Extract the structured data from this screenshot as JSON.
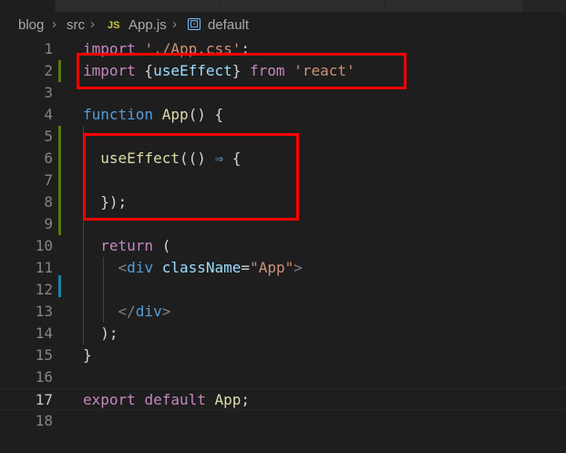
{
  "breadcrumb": {
    "folder1": "blog",
    "folder2": "src",
    "file_icon": "JS",
    "file": "App.js",
    "symbol_icon": "symbol-method-icon",
    "symbol": "default"
  },
  "colors": {
    "background": "#1e1e1e",
    "highlight_box": "#ff0000",
    "added_line_marker": "#587c0c",
    "modified_line_marker": "#1b81a8"
  },
  "editor": {
    "active_line": "17",
    "lines": [
      {
        "n": "1",
        "tokens": [
          [
            "kw",
            "import"
          ],
          [
            "punc",
            " "
          ],
          [
            "str",
            "'./App.css'"
          ],
          [
            "punc",
            ";"
          ]
        ]
      },
      {
        "n": "2",
        "tokens": [
          [
            "kw",
            "import"
          ],
          [
            "punc",
            " {"
          ],
          [
            "var",
            "useEffect"
          ],
          [
            "punc",
            "} "
          ],
          [
            "kw",
            "from"
          ],
          [
            "punc",
            " "
          ],
          [
            "str",
            "'react'"
          ]
        ]
      },
      {
        "n": "3",
        "tokens": []
      },
      {
        "n": "4",
        "tokens": [
          [
            "decl",
            "function"
          ],
          [
            "punc",
            " "
          ],
          [
            "fn",
            "App"
          ],
          [
            "punc",
            "() {"
          ]
        ]
      },
      {
        "n": "5",
        "tokens": []
      },
      {
        "n": "6",
        "tokens": [
          [
            "punc",
            "  "
          ],
          [
            "fn",
            "useEffect"
          ],
          [
            "punc",
            "(() "
          ],
          [
            "op",
            "⇒"
          ],
          [
            "punc",
            " {"
          ]
        ]
      },
      {
        "n": "7",
        "tokens": []
      },
      {
        "n": "8",
        "tokens": [
          [
            "punc",
            "  });"
          ]
        ]
      },
      {
        "n": "9",
        "tokens": []
      },
      {
        "n": "10",
        "tokens": [
          [
            "punc",
            "  "
          ],
          [
            "kw",
            "return"
          ],
          [
            "punc",
            " ("
          ]
        ]
      },
      {
        "n": "11",
        "tokens": [
          [
            "punc",
            "    "
          ],
          [
            "tagb",
            "<"
          ],
          [
            "tag",
            "div"
          ],
          [
            "punc",
            " "
          ],
          [
            "var",
            "className"
          ],
          [
            "punc",
            "="
          ],
          [
            "str",
            "\"App\""
          ],
          [
            "tagb",
            ">"
          ]
        ]
      },
      {
        "n": "12",
        "tokens": []
      },
      {
        "n": "13",
        "tokens": [
          [
            "punc",
            "    "
          ],
          [
            "tagb",
            "</"
          ],
          [
            "tag",
            "div"
          ],
          [
            "tagb",
            ">"
          ]
        ]
      },
      {
        "n": "14",
        "tokens": [
          [
            "punc",
            "  );"
          ]
        ]
      },
      {
        "n": "15",
        "tokens": [
          [
            "punc",
            "}"
          ]
        ]
      },
      {
        "n": "16",
        "tokens": []
      },
      {
        "n": "17",
        "tokens": [
          [
            "kw",
            "export"
          ],
          [
            "punc",
            " "
          ],
          [
            "kw",
            "default"
          ],
          [
            "punc",
            " "
          ],
          [
            "fn",
            "App"
          ],
          [
            "punc",
            ";"
          ]
        ]
      },
      {
        "n": "18",
        "tokens": []
      }
    ]
  }
}
